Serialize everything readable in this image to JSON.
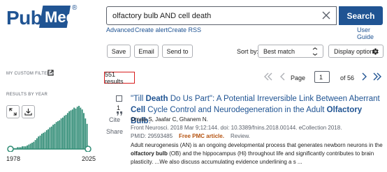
{
  "header": {
    "logo_pub": "Pub",
    "logo_med": "Med",
    "logo_reg": "®",
    "search_value": "olfactory bulb AND cell death",
    "search_button": "Search",
    "links": {
      "advanced": "Advanced",
      "create_alert": "Create alert",
      "create_rss": "Create RSS",
      "user_guide": "User Guide"
    }
  },
  "toolbar": {
    "save": "Save",
    "email": "Email",
    "send_to": "Send to",
    "sort_by_label": "Sort by:",
    "sort_value": "Best match",
    "display_options": "Display options"
  },
  "sidebar": {
    "custom_filters": "MY CUSTOM FILTERS",
    "results_by_year": "RESULTS BY YEAR",
    "year_start": "1978",
    "year_end": "2025",
    "histogram": [
      1,
      1,
      1,
      1,
      2,
      2,
      2,
      3,
      3,
      3,
      4,
      5,
      6,
      7,
      8,
      10,
      12,
      14,
      15,
      17,
      18,
      19,
      21,
      22,
      24,
      25,
      27,
      28,
      30,
      31,
      32,
      34,
      35,
      37,
      38,
      40,
      42,
      43,
      44,
      46,
      45,
      47,
      48,
      46,
      44,
      40,
      34,
      28
    ]
  },
  "results": {
    "count": "551 results",
    "page_label": "Page",
    "page_value": "1",
    "page_of": "of 56"
  },
  "item": {
    "number": "1",
    "cite": "Cite",
    "share": "Share",
    "title_segments": [
      {
        "t": "\"Till ",
        "b": false
      },
      {
        "t": "Death",
        "b": true
      },
      {
        "t": " Do Us Part\": A Potential Irreversible Link Between Aberrant ",
        "b": false
      },
      {
        "t": "Cell",
        "b": true
      },
      {
        "t": " Cycle Control and Neurodegeneration in the Adult ",
        "b": false
      },
      {
        "t": "Olfactory Bulb",
        "b": true
      },
      {
        "t": ".",
        "b": false
      }
    ],
    "authors": "Omais S, Jaafar C, Ghanem N.",
    "journal": "Front Neurosci. 2018 Mar 9;12:144. doi: 10.3389/fnins.2018.00144. eCollection 2018.",
    "pmid": "PMID: 29593485",
    "free": "Free PMC article.",
    "type": "Review.",
    "snippet_segments": [
      {
        "t": "Adult neurogenesis (AN) is an ongoing developmental process that generates newborn neurons in the ",
        "b": false
      },
      {
        "t": "olfactory bulb",
        "b": true
      },
      {
        "t": " (OB) and the hippocampus (Hi) throughout life and significantly contributes to brain plasticity. ...We also discuss accumulating evidence underlining a s ...",
        "b": false
      }
    ]
  },
  "colors": {
    "brand": "#205493",
    "histogram": "#2e8b74",
    "highlight_box": "#d81e1e",
    "free_article": "#b5520f"
  }
}
